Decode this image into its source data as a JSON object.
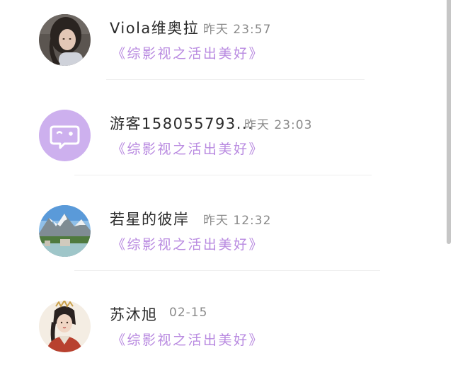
{
  "comments": [
    {
      "name": "Viola维奥拉",
      "time": "昨天 23:57",
      "text": "《综影视之活出美好》",
      "avatar_icon": "user-photo-girl"
    },
    {
      "name": "游客158055793...",
      "time": "昨天 23:03",
      "text": "《综影视之活出美好》",
      "avatar_icon": "guest-chat-bubble-icon"
    },
    {
      "name": "若星的彼岸",
      "time": "昨天 12:32",
      "text": "《综影视之活出美好》",
      "avatar_icon": "landscape-mountain-photo"
    },
    {
      "name": "苏沐旭",
      "time": "02-15",
      "text": "《综影视之活出美好》",
      "avatar_icon": "costume-character-photo"
    }
  ],
  "colors": {
    "accent": "#b889e0",
    "guest_avatar_bg": "#cdb0ee",
    "name_text": "#2b2b2b",
    "time_text": "#8a8a8a"
  }
}
